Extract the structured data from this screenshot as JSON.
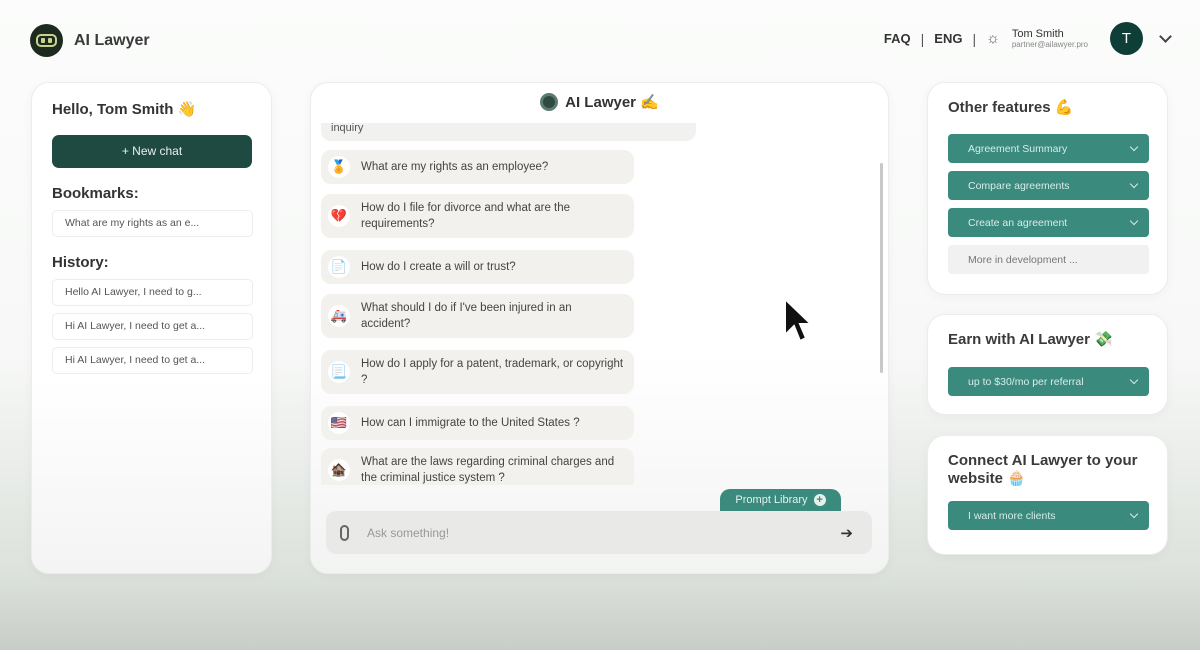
{
  "app": {
    "brand": "AI Lawyer"
  },
  "nav": {
    "faq": "FAQ",
    "lang": "ENG",
    "sep": "|",
    "theme_icon": "sun-icon",
    "user_name": "Tom Smith",
    "user_email": "partner@ailawyer.pro",
    "avatar_initial": "T"
  },
  "sidebar": {
    "greeting": "Hello, Tom Smith 👋",
    "new_chat_label": "+ New chat",
    "bookmarks_title": "Bookmarks:",
    "bookmarks": [
      {
        "label": "What are my rights as an e..."
      }
    ],
    "history_title": "History:",
    "history": [
      {
        "label": "Hello AI Lawyer, I need to g..."
      },
      {
        "label": "Hi AI Lawyer, I need to get a..."
      },
      {
        "label": "Hi AI Lawyer, I need to get a..."
      }
    ]
  },
  "chat": {
    "title": "AI Lawyer ✍️",
    "previous_message_tail": "inquiry",
    "prompts": [
      {
        "emoji": "🏅",
        "text": "What are my rights as an employee?"
      },
      {
        "emoji": "💔",
        "text": "How do I file for divorce and what are the requirements?"
      },
      {
        "emoji": "📄",
        "text": "How do I create a will or trust?"
      },
      {
        "emoji": "🚑",
        "text": "What should I do if I've been injured in an accident?"
      },
      {
        "emoji": "📃",
        "text": "How do I apply for a patent, trademark, or copyright ?"
      },
      {
        "emoji": "🇺🇸",
        "text": "How can I immigrate to the United States ?"
      },
      {
        "emoji": "🏚️",
        "text": "What are the laws regarding criminal charges and the criminal justice system ?"
      }
    ],
    "prompt_library_label": "Prompt Library",
    "input_placeholder": "Ask something!",
    "input_value": ""
  },
  "features": {
    "title": "Other features 💪",
    "items": [
      {
        "label": "Agreement Summary"
      },
      {
        "label": "Compare agreements"
      },
      {
        "label": "Create an agreement"
      }
    ],
    "more_label": "More in development ..."
  },
  "earn": {
    "title": "Earn with AI Lawyer 💸",
    "button_label": "up to $30/mo per referral"
  },
  "connect": {
    "title": "Connect AI Lawyer to your website 🧁",
    "button_label": "I want more clients"
  },
  "colors": {
    "accent_teal": "#3a8a7e",
    "dark_green": "#1f4a42",
    "avatar_bg": "#0f3d37"
  }
}
